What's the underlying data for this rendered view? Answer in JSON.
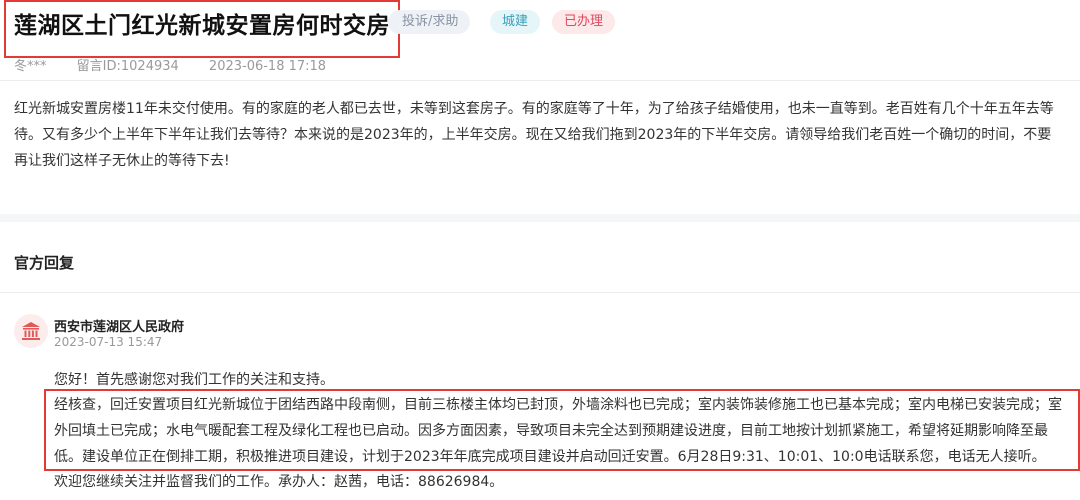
{
  "header": {
    "title": "莲湖区土门红光新城安置房何时交房",
    "tags": {
      "type": "投诉/求助",
      "category": "城建",
      "status": "已办理"
    },
    "meta": {
      "author": "冬***",
      "message_id": "留言ID:1024934",
      "date": "2023-06-18 17:18"
    }
  },
  "message": {
    "body": "红光新城安置房楼11年未交付使用。有的家庭的老人都已去世，未等到这套房子。有的家庭等了十年，为了给孩子结婚使用，也未一直等到。老百姓有几个十年五年去等待。又有多少个上半年下半年让我们去等待？本来说的是2023年的，上半年交房。现在又给我们拖到2023年的下半年交房。请领导给我们老百姓一个确切的时间，不要再让我们这样子无休止的等待下去!"
  },
  "reply_section": {
    "title": "官方回复",
    "department": "西安市莲湖区人民政府",
    "date": "2023-07-13 15:47",
    "greeting": "您好！首先感谢您对我们工作的关注和支持。",
    "main": "经核查，回迁安置项目红光新城位于团结西路中段南侧，目前三栋楼主体均已封顶，外墙涂料也已完成；室内装饰装修施工也已基本完成；室内电梯已安装完成；室外回填土已完成；水电气暖配套工程及绿化工程也已启动。因多方面因素，导致项目未完全达到预期建设进度，目前工地按计划抓紧施工，希望将延期影响降至最低。建设单位正在倒排工期，积极推进项目建设，计划于2023年年底完成项目建设并启动回迁安置。6月28日9:31、10:01、10:0电话联系您，电话无人接听。",
    "closing": "欢迎您继续关注并监督我们的工作。承办人：赵茜，电话：88626984。"
  },
  "icons": {
    "department_icon": "government-building-icon"
  },
  "colors": {
    "highlight_border": "#e53935",
    "tag_status": "#e04a5a",
    "tag_category": "#3aa0b8"
  }
}
